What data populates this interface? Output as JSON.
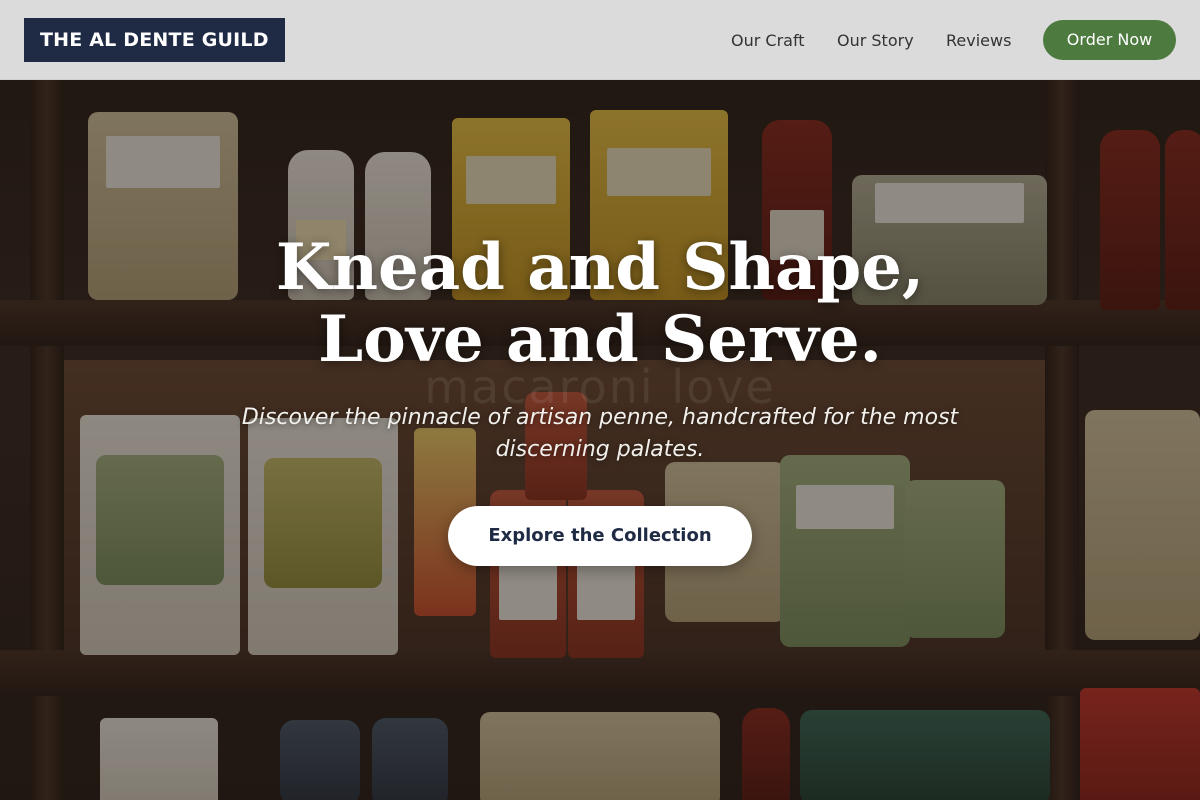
{
  "header": {
    "brand": "THE AL DENTE GUILD",
    "nav": [
      {
        "label": "Our Craft"
      },
      {
        "label": "Our Story"
      },
      {
        "label": "Reviews"
      }
    ],
    "order_button": "Order Now"
  },
  "hero": {
    "headline_line1": "Knead and Shape,",
    "headline_line2": "Love and Serve.",
    "watermark": "macaroni love",
    "subtitle": "Discover the pinnacle of artisan penne, handcrafted for the most discerning palates.",
    "cta": "Explore the Collection",
    "background_image": "pasta-shop-shelves-photo"
  },
  "colors": {
    "brand_bg": "#1f2a44",
    "order_green": "#4c7a3f",
    "header_bg": "#ebebeb"
  }
}
